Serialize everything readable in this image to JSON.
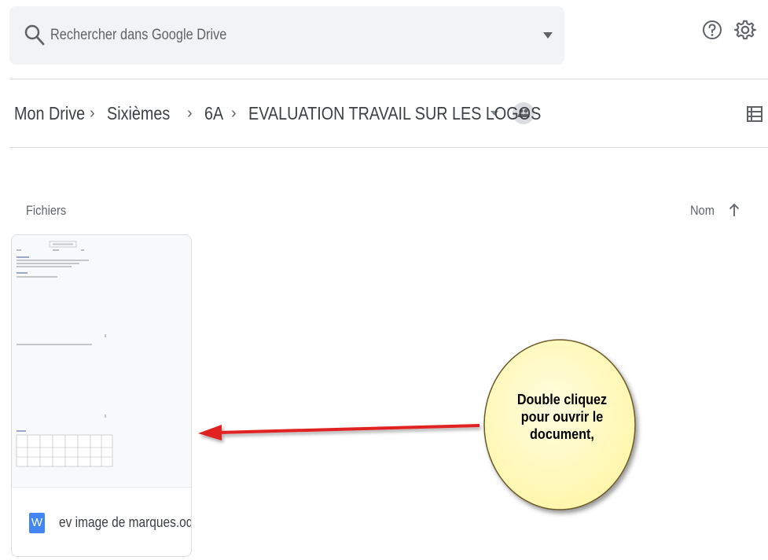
{
  "search": {
    "placeholder": "Rechercher dans Google Drive",
    "icon": "search-icon",
    "options_icon": "caret-down-icon"
  },
  "header_icons": [
    "help-icon",
    "settings-icon"
  ],
  "breadcrumb": {
    "items": [
      "Mon Drive",
      "Sixièmes",
      "6A",
      "EVALUATION TRAVAIL SUR LES LOGOS"
    ],
    "separator": "›",
    "shared_icon": "people-icon"
  },
  "view_toggle_icon": "list-view-icon",
  "section": {
    "label": "Fichiers",
    "sort_label": "Nom",
    "sort_direction": "ascending"
  },
  "files": [
    {
      "name": "ev image de marques.odt",
      "icon": "word-doc-icon",
      "icon_letter": "W"
    }
  ],
  "callout": {
    "lines": [
      "Double cliquez",
      "pour ouvrir le",
      "document,"
    ]
  },
  "colors": {
    "search_bg": "#f1f3f4",
    "doc_icon": "#4285f4",
    "arrow": "#e02020",
    "callout_fill": "#fffbc0"
  }
}
